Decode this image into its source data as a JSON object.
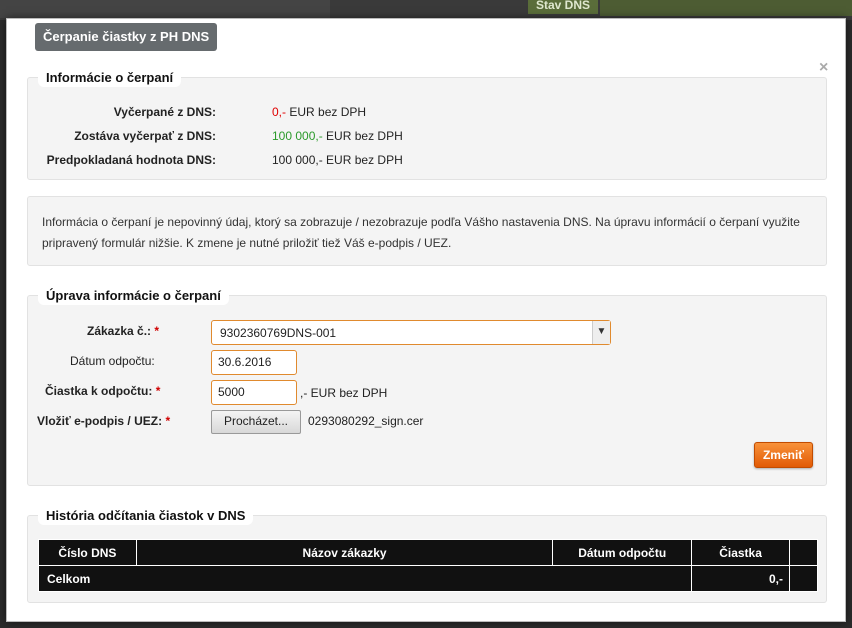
{
  "background": {
    "tab_label": "Stav DNS"
  },
  "modal": {
    "title": "Čerpanie čiastky z PH DNS",
    "close_glyph": "×"
  },
  "info": {
    "legend": "Informácie o čerpaní",
    "rows": [
      {
        "label": "Vyčerpané z DNS:",
        "amount": "0,-",
        "unit": " EUR bez DPH",
        "amount_color": "red"
      },
      {
        "label": "Zostáva vyčerpať z DNS:",
        "amount": "100 000,-",
        "unit": " EUR bez DPH",
        "amount_color": "green"
      },
      {
        "label": "Predpokladaná hodnota DNS:",
        "amount": "100 000,-",
        "unit": " EUR bez DPH",
        "amount_color": "default"
      }
    ]
  },
  "note": {
    "text": "Informácia o čerpaní je nepovinný údaj, ktorý sa zobrazuje / nezobrazuje podľa Vášho nastavenia DNS. Na úpravu informácií o čerpaní využite pripravený formulár nižšie. K zmene je nutné priložiť tiež Váš e-podpis / UEZ."
  },
  "form": {
    "legend": "Úprava informácie o čerpaní",
    "zakazka_label": "Zákazka č.:",
    "zakazka_value": "9302360769DNS-001",
    "datum_label": "Dátum odpočtu:",
    "datum_value": "30.6.2016",
    "ciastka_label": "Čiastka k odpočtu:",
    "ciastka_value": "5000",
    "ciastka_unit": ",- EUR bez DPH",
    "epodpis_label": "Vložiť e-podpis / UEZ:",
    "browse_label": "Procházet...",
    "file_name": "0293080292_sign.cer",
    "required_mark": "*",
    "submit_label": "Zmeniť"
  },
  "history": {
    "legend": "História odčítania čiastok v DNS",
    "columns": [
      "Číslo DNS",
      "Názov zákazky",
      "Dátum odpočtu",
      "Čiastka",
      ""
    ],
    "total_label": "Celkom",
    "total_value": "0,-"
  },
  "colors": {
    "accent_orange": "#e25a05",
    "red": "#e00000",
    "green": "#2a9a2a",
    "table_header": "#111111"
  }
}
